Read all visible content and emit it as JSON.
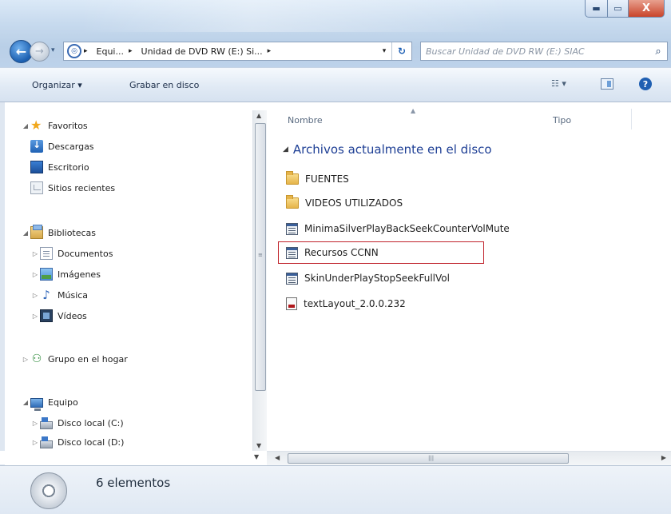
{
  "window": {
    "caption": {
      "min": "▬",
      "max": "▭",
      "close": "X"
    }
  },
  "nav": {
    "back": "←",
    "forward": "→",
    "recent": "▾"
  },
  "address": {
    "crumbs": [
      "Equi...",
      "Unidad de DVD RW (E:) Si..."
    ],
    "separator": "▸",
    "dropdown": "▾",
    "refresh": "↻"
  },
  "search": {
    "placeholder": "Buscar Unidad de DVD RW (E:) SIAC",
    "icon": "⌕"
  },
  "toolbar": {
    "organize_label": "Organizar ▾",
    "burn_label": "Grabar en disco",
    "views": "☷ ▾",
    "help": "?"
  },
  "sidebar": {
    "favorites": {
      "label": "Favoritos",
      "items": [
        {
          "label": "Descargas",
          "icon": "downloads-icon"
        },
        {
          "label": "Escritorio",
          "icon": "desktop-icon"
        },
        {
          "label": "Sitios recientes",
          "icon": "recent-places-icon"
        }
      ]
    },
    "libraries": {
      "label": "Bibliotecas",
      "items": [
        {
          "label": "Documentos",
          "icon": "documents-icon"
        },
        {
          "label": "Imágenes",
          "icon": "pictures-icon"
        },
        {
          "label": "Música",
          "icon": "music-icon"
        },
        {
          "label": "Vídeos",
          "icon": "videos-icon"
        }
      ]
    },
    "homegroup": {
      "label": "Grupo en el hogar"
    },
    "computer": {
      "label": "Equipo",
      "items": [
        {
          "label": "Disco local (C:)",
          "icon": "local-disk-icon"
        },
        {
          "label": "Disco local (D:)",
          "icon": "local-disk-icon"
        }
      ]
    }
  },
  "columns": {
    "name": "Nombre",
    "type": "Tipo"
  },
  "group": {
    "label": "Archivos actualmente en el disco"
  },
  "files": [
    {
      "name": "FUENTES",
      "kind": "folder"
    },
    {
      "name": "VIDEOS UTILIZADOS",
      "kind": "folder"
    },
    {
      "name": "MinimaSilverPlayBackSeekCounterVolMute",
      "kind": "swf"
    },
    {
      "name": "Recursos CCNN",
      "kind": "swf",
      "highlighted": true
    },
    {
      "name": "SkinUnderPlayStopSeekFullVol",
      "kind": "swf"
    },
    {
      "name": "textLayout_2.0.0.232",
      "kind": "file"
    }
  ],
  "status": {
    "count_text": "6 elementos"
  },
  "colors": {
    "highlight_border": "#c0232b",
    "group_heading": "#1e3f95"
  }
}
